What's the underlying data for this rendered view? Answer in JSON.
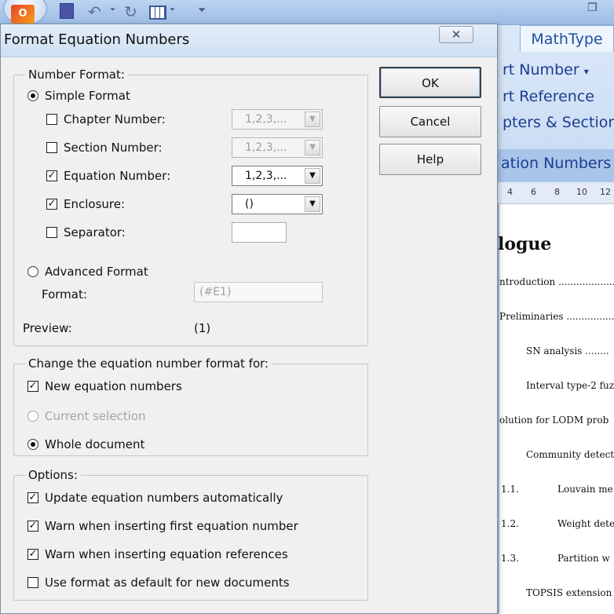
{
  "background": {
    "ribbon": {
      "tab": "MathType",
      "commands": [
        "rt Number",
        "rt Reference",
        "pters & Sections"
      ],
      "group_label": "ation Numbers",
      "number_dropdown_arrow": "▾"
    },
    "ruler": [
      "4",
      "6",
      "8",
      "10",
      "12"
    ],
    "document": {
      "heading": "logue",
      "lines": [
        "ntroduction ........................",
        "Preliminaries ........................",
        "SN analysis ........",
        "Interval type-2 fuz",
        "olution for LODM prob",
        "Community detect",
        "1.1.",
        "Louvain me",
        "1.2.",
        "Weight dete",
        "1.3.",
        "Partition w",
        "TOPSIS extension"
      ]
    },
    "quick_access": {
      "logo_text": "O",
      "undo_glyph": "↶",
      "redo_glyph": "↻",
      "more_glyph": "⏷",
      "restore_glyph": "❐"
    }
  },
  "dialog": {
    "title": "Format Equation Numbers",
    "close_label": "✕",
    "number_format": {
      "legend": "Number Format:",
      "simple_format": {
        "label": "Simple Format",
        "checked": true
      },
      "chapter_number": {
        "label": "Chapter Number:",
        "checked": false,
        "value": "1,2,3,..."
      },
      "section_number": {
        "label": "Section Number:",
        "checked": false,
        "value": "1,2,3,..."
      },
      "equation_number": {
        "label": "Equation Number:",
        "checked": true,
        "value": "1,2,3,..."
      },
      "enclosure": {
        "label": "Enclosure:",
        "checked": true,
        "value": "()"
      },
      "separator": {
        "label": "Separator:",
        "checked": false,
        "value": ""
      },
      "advanced_format": {
        "label": "Advanced Format",
        "checked": false
      },
      "format_label": "Format:",
      "format_value": "(#E1)",
      "preview_label": "Preview:",
      "preview_value": "(1)"
    },
    "change_for": {
      "legend": "Change the equation number format for:",
      "new_equations": {
        "label": "New equation numbers",
        "checked": true
      },
      "current_selection": {
        "label": "Current selection",
        "checked": false,
        "disabled": true
      },
      "whole_document": {
        "label": "Whole document",
        "checked": true
      }
    },
    "options": {
      "legend": "Options:",
      "items": [
        {
          "label": "Update equation numbers automatically",
          "checked": true
        },
        {
          "label": "Warn when inserting first equation number",
          "checked": true
        },
        {
          "label": "Warn when inserting equation references",
          "checked": true
        },
        {
          "label": "Use format as default for new documents",
          "checked": false
        }
      ]
    },
    "buttons": {
      "ok": "OK",
      "cancel": "Cancel",
      "help": "Help"
    },
    "checkmark": "✓",
    "dropdown_arrow": "▼"
  }
}
